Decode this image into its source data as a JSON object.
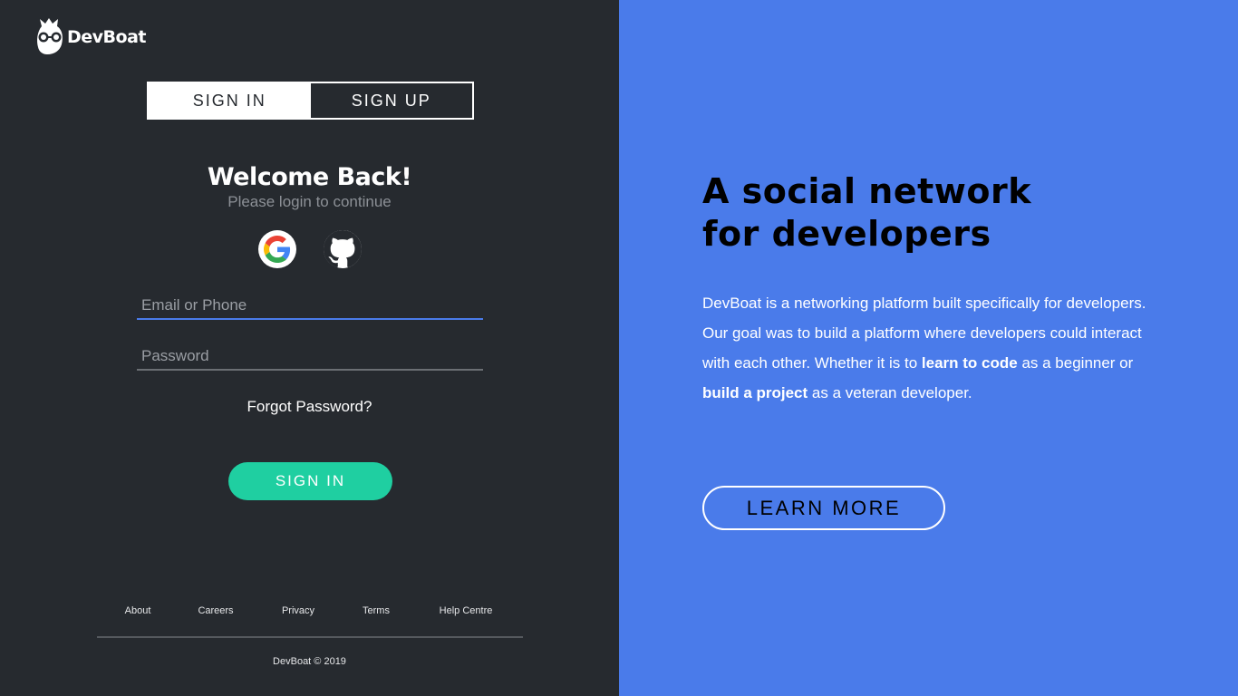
{
  "brand": {
    "name": "DevBoat",
    "logo_icon": "devboat-owl-icon"
  },
  "auth_tabs": [
    {
      "label": "SIGN IN",
      "active": true
    },
    {
      "label": "SIGN UP",
      "active": false
    }
  ],
  "login": {
    "title": "Welcome Back!",
    "subtitle": "Please login to continue",
    "social": [
      {
        "icon": "google-icon"
      },
      {
        "icon": "github-icon"
      }
    ],
    "email_placeholder": "Email or Phone",
    "email_value": "",
    "password_placeholder": "Password",
    "password_value": "",
    "forgot_label": "Forgot Password?",
    "submit_label": "SIGN IN"
  },
  "footer": {
    "links": [
      "About",
      "Careers",
      "Privacy",
      "Terms",
      "Help Centre"
    ],
    "copyright": "DevBoat © 2019"
  },
  "hero": {
    "headline_line1": "A social network",
    "headline_line2": "for developers",
    "description_part1": "DevBoat is a networking platform built specifically for developers. Our goal was to build a platform where developers could interact with each other. Whether it is to ",
    "description_bold1": "learn to code",
    "description_part2": " as a beginner or ",
    "description_bold2": "build a project",
    "description_part3": " as a veteran developer.",
    "cta_label": "LEARN MORE"
  },
  "colors": {
    "left_background": "#262a2f",
    "right_background": "#4a7bea",
    "accent_green": "#1fcfa1",
    "accent_blue": "#4a7bea"
  }
}
